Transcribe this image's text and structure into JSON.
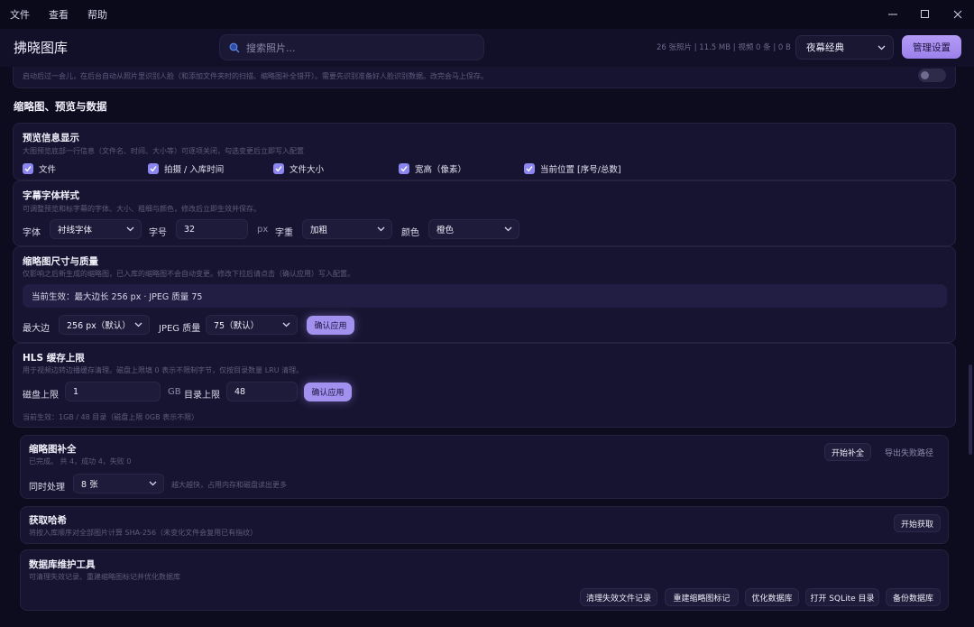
{
  "menubar": {
    "items": [
      "文件",
      "查看",
      "帮助"
    ]
  },
  "header": {
    "app_title": "拂晓图库",
    "search_placeholder": "搜索照片...",
    "stats": "26 张照片 | 11.5 MB | 视频 0 条 | 0 B",
    "theme": "夜幕经典",
    "manage_label": "管理设置"
  },
  "face_card": {
    "desc": "启动后过一会儿，在后台自动从照片里识别人脸（和添加文件夹时的扫描、缩略图补全错开）。需要先识别准备好人脸识别数据。改完会马上保存。",
    "enabled": false
  },
  "section": {
    "title": "缩略图、预览与数据"
  },
  "preview_info": {
    "title": "预览信息显示",
    "desc": "大图预览底部一行信息（文件名、时间、大小等）可逐项关闭，勾选变更后立即写入配置",
    "checkboxes": [
      {
        "label": "文件",
        "checked": true
      },
      {
        "label": "拍摄 / 入库时间",
        "checked": true
      },
      {
        "label": "文件大小",
        "checked": true
      },
      {
        "label": "宽高（像素）",
        "checked": true
      },
      {
        "label": "当前位置 [序号/总数]",
        "checked": true
      }
    ]
  },
  "subtitle_font": {
    "title": "字幕字体样式",
    "desc": "可调整预览和标字幕的字体、大小、粗细与颜色，修改后立即生效并保存。",
    "font_label": "字体",
    "font_value": "衬线字体",
    "size_label": "字号",
    "size_value": "32",
    "size_unit": "px",
    "weight_label": "字重",
    "weight_value": "加粗",
    "color_label": "颜色",
    "color_value": "橙色"
  },
  "thumb_size": {
    "title": "缩略图尺寸与质量",
    "desc": "仅影响之后新生成的缩略图，已入库的缩略图不会自动变更。修改下拉后请点击（确认应用）写入配置。",
    "current": "当前生效：最大边长 256 px · JPEG 质量 75",
    "edge_label": "最大边",
    "edge_value": "256 px（默认）",
    "quality_label": "JPEG 质量",
    "quality_value": "75（默认）",
    "apply_label": "确认应用"
  },
  "hls": {
    "title": "HLS 缓存上限",
    "desc": "用于视频边转边播缓存清理。磁盘上限填 0 表示不限制字节，仅按目录数量 LRU 清理。",
    "disk_label": "磁盘上限",
    "disk_value": "1",
    "disk_unit": "GB",
    "dir_label": "目录上限",
    "dir_value": "48",
    "apply_label": "确认应用",
    "current": "当前生效：1GB / 48 目录（磁盘上限 0GB 表示不限）"
  },
  "thumb_fill": {
    "title": "缩略图补全",
    "desc": "已完成。 共 4，成功 4，失败 0",
    "start_label": "开始补全",
    "export_label": "导出失败路径",
    "concurrency_label": "同时处理",
    "concurrency_value": "8 张",
    "hint": "越大越快，占用内存和磁盘读出更多"
  },
  "hash": {
    "title": "获取哈希",
    "desc": "将按入库顺序对全部图片计算 SHA-256（未变化文件会复用已有指纹）",
    "start_label": "开始获取"
  },
  "db_tools": {
    "title": "数据库维护工具",
    "desc": "可清理失效记录、重建缩略图标记并优化数据库",
    "buttons": [
      "清理失效文件记录",
      "重建缩略图标记",
      "优化数据库",
      "打开 SQLite 目录",
      "备份数据库"
    ]
  }
}
